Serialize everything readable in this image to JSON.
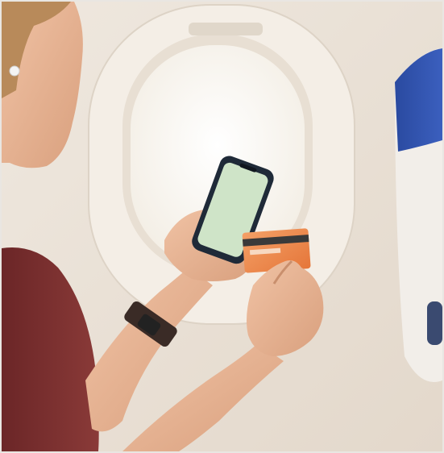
{
  "scene": {
    "subject": "",
    "colors": {
      "cabin_wall": "#ebe3d9",
      "window_bezel": "#f2ece4",
      "window_light": "#fbf8f1",
      "phone_body": "#1f2a38",
      "phone_screen": "#cfe4c8",
      "card": "#f08a4b",
      "shirt": "#7a2e2f",
      "skin": "#e8b493",
      "seat_blue": "#2c4fa6",
      "seat_white": "#f4f1ee",
      "watch": "#3a2b26"
    }
  }
}
